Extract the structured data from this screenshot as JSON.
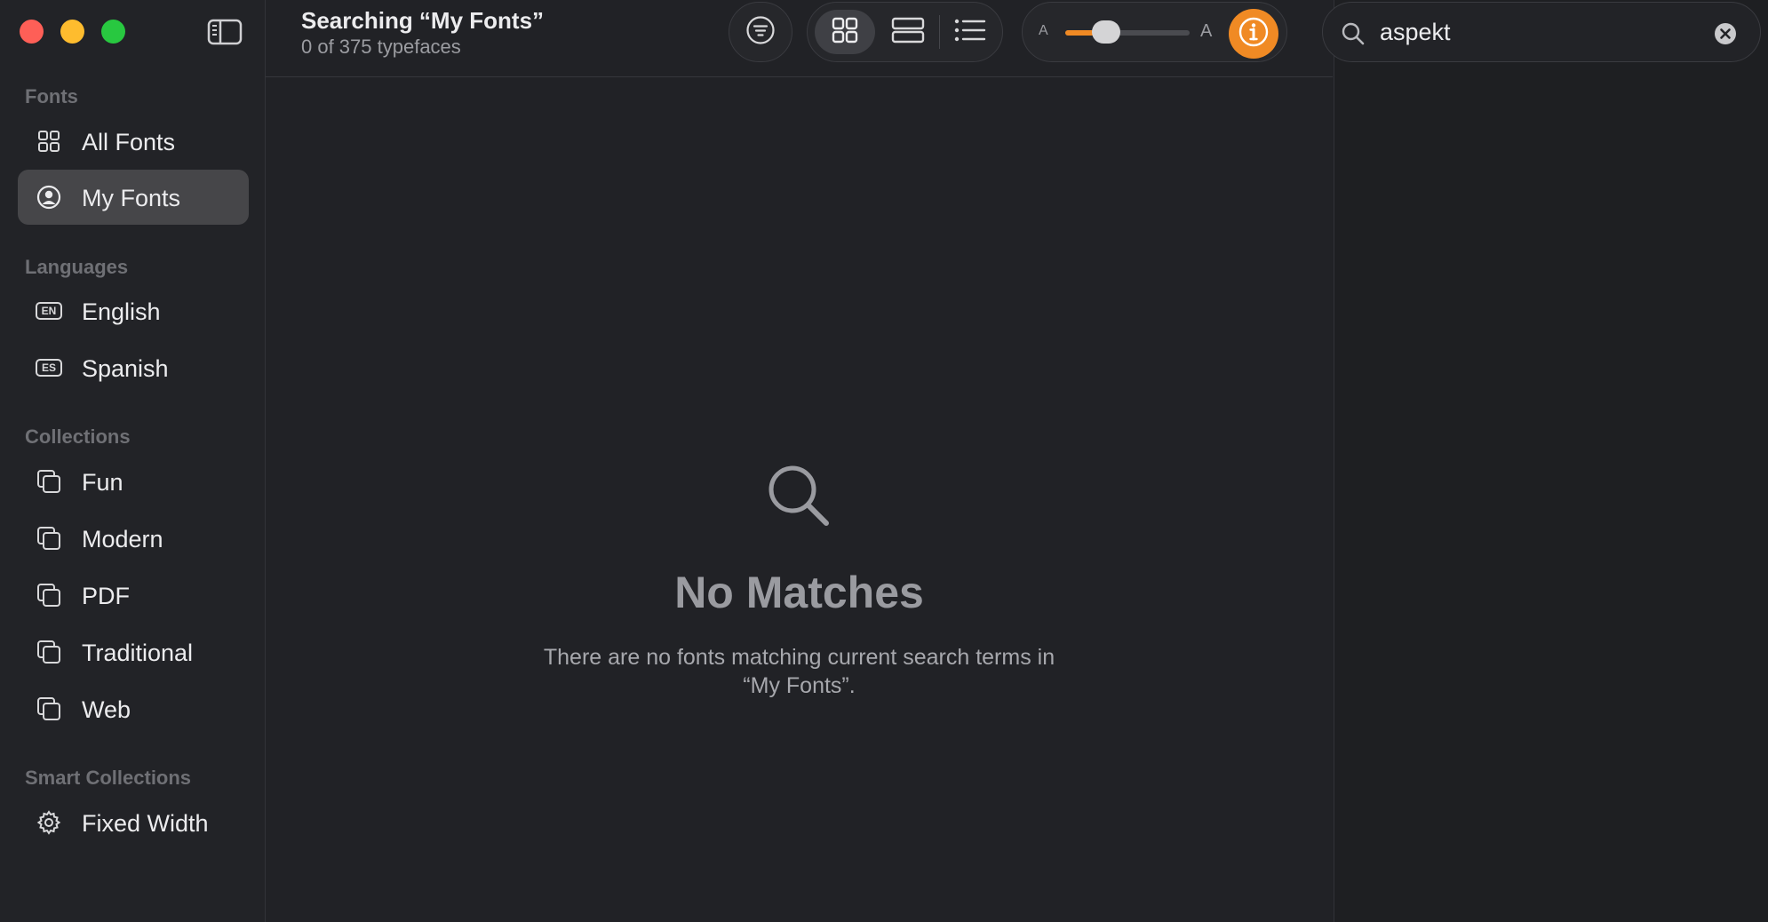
{
  "window": {
    "title": "Searching “My Fonts”",
    "subtitle": "0 of 375 typefaces"
  },
  "sidebar": {
    "sections": {
      "fonts": "Fonts",
      "languages": "Languages",
      "collections": "Collections",
      "smart_collections": "Smart Collections"
    },
    "items": [
      {
        "label": "All Fonts",
        "icon": "grid-icon"
      },
      {
        "label": "My Fonts",
        "icon": "person-circle-icon",
        "selected": true
      },
      {
        "label": "English",
        "icon": "en-badge-icon",
        "badge": "EN"
      },
      {
        "label": "Spanish",
        "icon": "es-badge-icon",
        "badge": "ES"
      },
      {
        "label": "Fun",
        "icon": "collection-icon"
      },
      {
        "label": "Modern",
        "icon": "collection-icon"
      },
      {
        "label": "PDF",
        "icon": "collection-icon"
      },
      {
        "label": "Traditional",
        "icon": "collection-icon"
      },
      {
        "label": "Web",
        "icon": "collection-icon"
      },
      {
        "label": "Fixed Width",
        "icon": "gear-icon"
      }
    ]
  },
  "toolbar": {
    "size_slider_min_label": "A",
    "size_slider_max_label": "A",
    "size_slider_level": 0.33,
    "accent_color": "#f08a24"
  },
  "search": {
    "value": "aspekt"
  },
  "empty_state": {
    "title": "No Matches",
    "description_line1": "There are no fonts matching current search terms in",
    "description_line2": "“My Fonts”."
  }
}
